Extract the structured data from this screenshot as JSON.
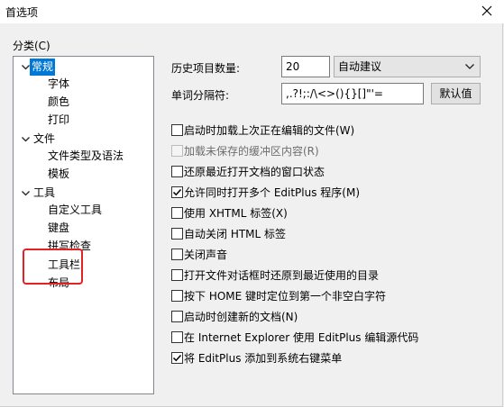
{
  "window": {
    "title": "首选项",
    "close_glyph": "✕"
  },
  "category": {
    "label": "分类(C)",
    "tree": [
      {
        "label": "常规",
        "expanded": true,
        "selected": true,
        "children": [
          "字体",
          "颜色",
          "打印"
        ]
      },
      {
        "label": "文件",
        "expanded": true,
        "children": [
          "文件类型及语法",
          "模板"
        ]
      },
      {
        "label": "工具",
        "expanded": true,
        "children": [
          "自定义工具",
          "键盘",
          "拼写检查",
          "工具栏",
          "布局"
        ]
      }
    ]
  },
  "general": {
    "history_label": "历史项目数量:",
    "history_value": "20",
    "history_mode": "自动建议",
    "word_sep_label": "单词分隔符:",
    "word_sep_value": ",.?!;:/\\<>(){}[]\"'=",
    "default_button": "默认值",
    "options": [
      {
        "label": "启动时加载上次正在编辑的文件(W)",
        "checked": false,
        "disabled": false
      },
      {
        "label": "加载未保存的缓冲区内容(R)",
        "checked": false,
        "disabled": true
      },
      {
        "label": "还原最近打开文档的窗口状态",
        "checked": false,
        "disabled": false
      },
      {
        "label": "允许同时打开多个 EditPlus 程序(M)",
        "checked": true,
        "disabled": false
      },
      {
        "label": "使用 XHTML 标签(X)",
        "checked": false,
        "disabled": false
      },
      {
        "label": "自动关闭 HTML 标签",
        "checked": false,
        "disabled": false
      },
      {
        "label": "关闭声音",
        "checked": false,
        "disabled": false
      },
      {
        "label": "打开文件对话框时还原到最近使用的目录",
        "checked": false,
        "disabled": false
      },
      {
        "label": "按下 HOME 键时定位到第一个非空白字符",
        "checked": false,
        "disabled": false
      },
      {
        "label": "启动时创建新的文档(N)",
        "checked": false,
        "disabled": false
      },
      {
        "label": "在 Internet Explorer 使用 EditPlus 编辑源代码",
        "checked": false,
        "disabled": false
      },
      {
        "label": "将 EditPlus 添加到系统右键菜单",
        "checked": true,
        "disabled": false
      }
    ]
  },
  "colors": {
    "selection": "#0078d7",
    "highlight_box": "#e32224"
  }
}
